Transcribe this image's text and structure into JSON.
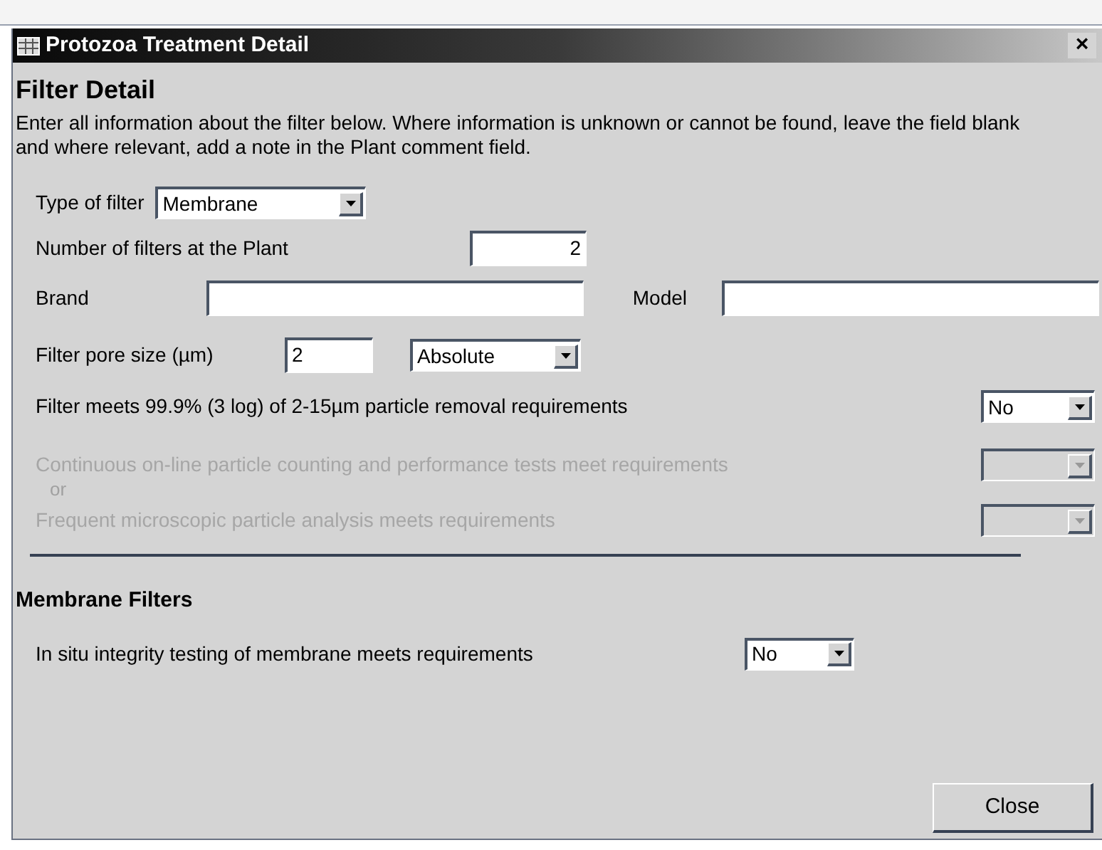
{
  "window": {
    "title": "Protozoa Treatment Detail",
    "close": "×"
  },
  "heading": "Filter Detail",
  "instructions": "Enter all information about the filter below.  Where information is unknown or cannot be found, leave the field blank and where relevant, add a note in the Plant comment field.",
  "filter_type": {
    "label": "Type of filter",
    "value": "Membrane"
  },
  "filter_count": {
    "label": "Number of filters at the Plant",
    "value": "2"
  },
  "brand": {
    "label": "Brand"
  },
  "model": {
    "label": "Model"
  },
  "pore_size": {
    "label": "Filter pore size (µm)",
    "value": "2",
    "rating": "Absolute"
  },
  "requirements": [
    {
      "kind": "question",
      "label": "Filter meets 99.9% (3 log) of 2-15µm particle removal requirements",
      "value": "No",
      "disabled": false
    },
    {
      "kind": "question",
      "label": "Continuous on-line particle counting and performance tests meet requirements",
      "disabled": true
    },
    {
      "kind": "conjunction",
      "label": "or"
    },
    {
      "kind": "question",
      "label": "Frequent microscopic particle analysis meets requirements",
      "disabled": true
    }
  ],
  "membrane_section": {
    "heading": "Membrane Filters",
    "questions": [
      {
        "label": "In situ integrity testing of membrane meets requirements",
        "value": "No",
        "disabled": false
      }
    ]
  },
  "buttons": [
    {
      "label": "Close"
    }
  ]
}
